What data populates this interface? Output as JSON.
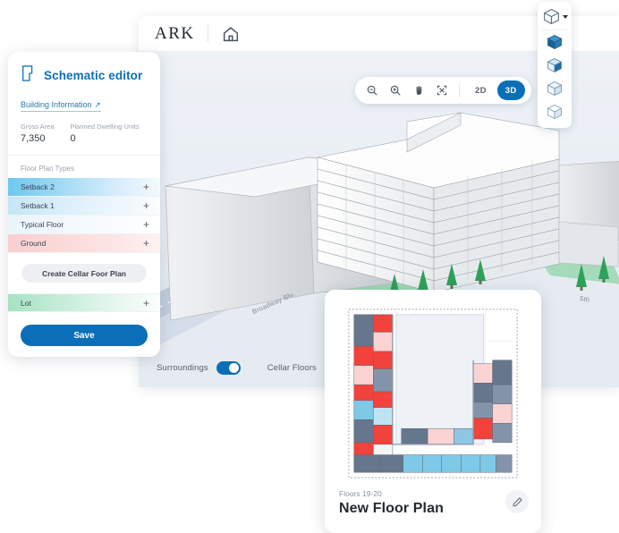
{
  "app": {
    "brand": "ARK",
    "home_icon": "home-icon"
  },
  "viewport": {
    "toolbar": {
      "zoom_out": "zoom-out-icon",
      "zoom_in": "zoom-in-icon",
      "pan": "hand-pan-icon",
      "fit": "fit-to-screen-icon",
      "mode_2d": "2D",
      "mode_3d": "3D",
      "active_mode": "3D"
    },
    "toggles": [
      {
        "label": "Surroundings",
        "on": true
      },
      {
        "label": "Cellar Floors",
        "on": false
      }
    ],
    "streets": [
      {
        "label": "Broadway Blv."
      },
      {
        "label": "5th"
      }
    ]
  },
  "view_styles": {
    "current_icon": "cube-outline-icon",
    "caret": "chevron-down-icon",
    "options": [
      {
        "name": "shaded-solid-cube-icon"
      },
      {
        "name": "shaded-cube-icon"
      },
      {
        "name": "light-cube-icon"
      },
      {
        "name": "outline-cube-icon"
      }
    ]
  },
  "editor": {
    "icon": "floor-plate-polygon-icon",
    "title": "Schematic editor",
    "link": {
      "label": "Building Information",
      "arrow": "↗"
    },
    "stats": [
      {
        "label": "Gross Area",
        "value": "7,350"
      },
      {
        "label": "Planned Dwelling Units",
        "value": "0"
      }
    ],
    "section_label": "Floor Plan Types",
    "floor_plan_types": [
      {
        "name": "Setback 2",
        "add": "+",
        "color_from": "#6dc8ef",
        "color_to": "#d9eefb"
      },
      {
        "name": "Setback 1",
        "add": "+",
        "color_from": "#c2e4f6",
        "color_to": "#f0f7fc"
      },
      {
        "name": "Typical Floor",
        "add": "+",
        "color_from": "#e9f4fb",
        "color_to": "#fbfdfe"
      },
      {
        "name": "Ground",
        "add": "+",
        "color_from": "#f9cfd0",
        "color_to": "#fdeeee"
      }
    ],
    "cellar_button": "Create Cellar Foor Plan",
    "lot": {
      "name": "Lot",
      "add": "+",
      "color_from": "#a6e2c2",
      "color_to": "#f2fbf6"
    },
    "save_button": "Save"
  },
  "floor_plan_card": {
    "thumbnail": "floor-plan-thumbnail",
    "sub": "Floors 19-20",
    "title": "New Floor Plan",
    "edit_icon": "pencil-edit-icon"
  },
  "colors": {
    "accent": "#0a6fb8",
    "link": "#2a78ad",
    "panel_bg": "#ffffff",
    "viewport_bg": "#e9eef5",
    "road": "#aec1d6",
    "lawn": "#8fd6a8",
    "tree": "#2fa05a",
    "massing": "#d7dade"
  }
}
